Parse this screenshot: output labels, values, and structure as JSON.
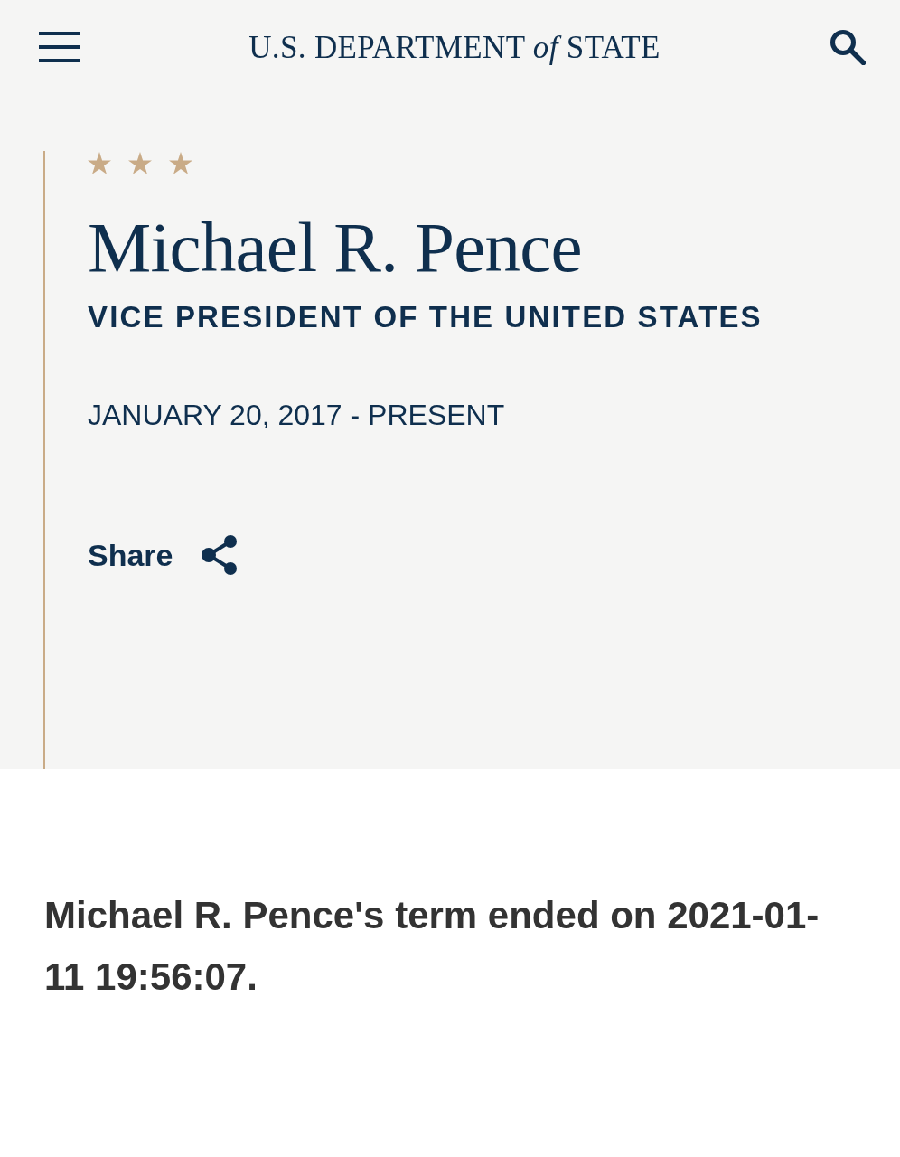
{
  "header": {
    "logo": "U.S. DEPARTMENT *of* STATE"
  },
  "profile": {
    "stars": 3,
    "name": "Michael R. Pence",
    "title": "VICE PRESIDENT OF THE UNITED STATES",
    "term": "JANUARY 20, 2017 - PRESENT",
    "share": {
      "label": "Share"
    }
  },
  "notice": {
    "text": "Michael R. Pence's term ended on 2021-01-11 19:56:07."
  }
}
